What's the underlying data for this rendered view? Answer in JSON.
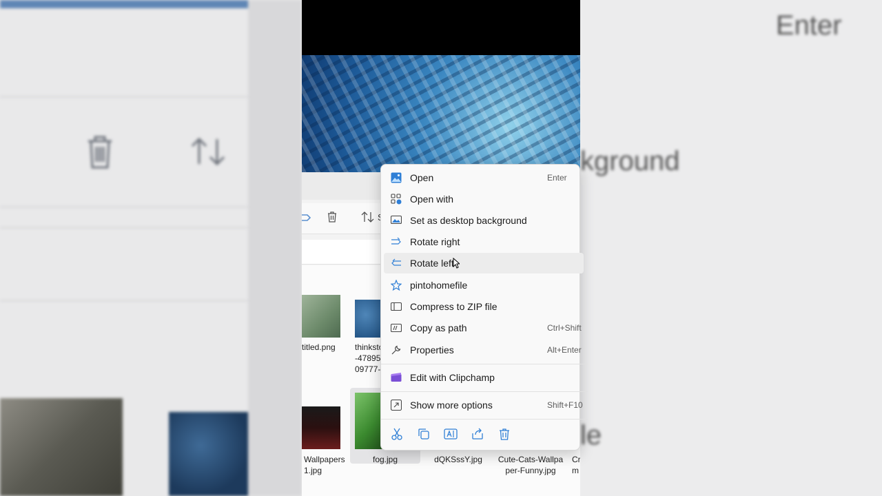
{
  "background": {
    "right_top_text": "Enter",
    "right_mid_text": "kground",
    "right_low_text": "le"
  },
  "explorer": {
    "files": [
      {
        "name_line1": "titled.png",
        "name_line2": "",
        "name_line3": ""
      },
      {
        "name_line1": "thinksto",
        "name_line2": "-47895",
        "name_line3": "09777-"
      },
      {
        "name_line1": "Wallpapers",
        "name_line2": "1.jpg",
        "name_line3": ""
      },
      {
        "name_line1": "fog.jpg",
        "name_line2": "",
        "name_line3": ""
      },
      {
        "name_line1": "dQKSssY.jpg",
        "name_line2": "",
        "name_line3": ""
      },
      {
        "name_line1": "Cute-Cats-Wallpa",
        "name_line2": "per-Funny.jpg",
        "name_line3": ""
      },
      {
        "name_line1": "Cr",
        "name_line2": "m",
        "name_line3": ""
      }
    ],
    "toolbar": {
      "sort_label": "S"
    }
  },
  "menu": {
    "items": [
      {
        "label": "Open",
        "shortcut": "Enter",
        "icon": "photo-app-icon"
      },
      {
        "label": "Open with",
        "shortcut": "",
        "icon": "open-with-icon"
      },
      {
        "label": "Set as desktop background",
        "shortcut": "",
        "icon": "desktop-background-icon"
      },
      {
        "label": "Rotate right",
        "shortcut": "",
        "icon": "rotate-right-icon"
      },
      {
        "label": "Rotate left",
        "shortcut": "",
        "icon": "rotate-left-icon"
      },
      {
        "label": "pintohomefile",
        "shortcut": "",
        "icon": "star-icon"
      },
      {
        "label": "Compress to ZIP file",
        "shortcut": "",
        "icon": "zip-icon"
      },
      {
        "label": "Copy as path",
        "shortcut": "Ctrl+Shift",
        "icon": "copy-path-icon"
      },
      {
        "label": "Properties",
        "shortcut": "Alt+Enter",
        "icon": "wrench-icon"
      },
      {
        "label": "Edit with Clipchamp",
        "shortcut": "",
        "icon": "clipchamp-icon"
      },
      {
        "label": "Show more options",
        "shortcut": "Shift+F10",
        "icon": "more-options-icon"
      }
    ],
    "quick_actions": [
      "cut-icon",
      "copy-icon",
      "rename-icon",
      "share-icon",
      "delete-icon"
    ]
  },
  "colors": {
    "accent": "#1a73c7",
    "menu_bg": "#f9f9f9",
    "clipchamp": "#7b4fd6"
  }
}
